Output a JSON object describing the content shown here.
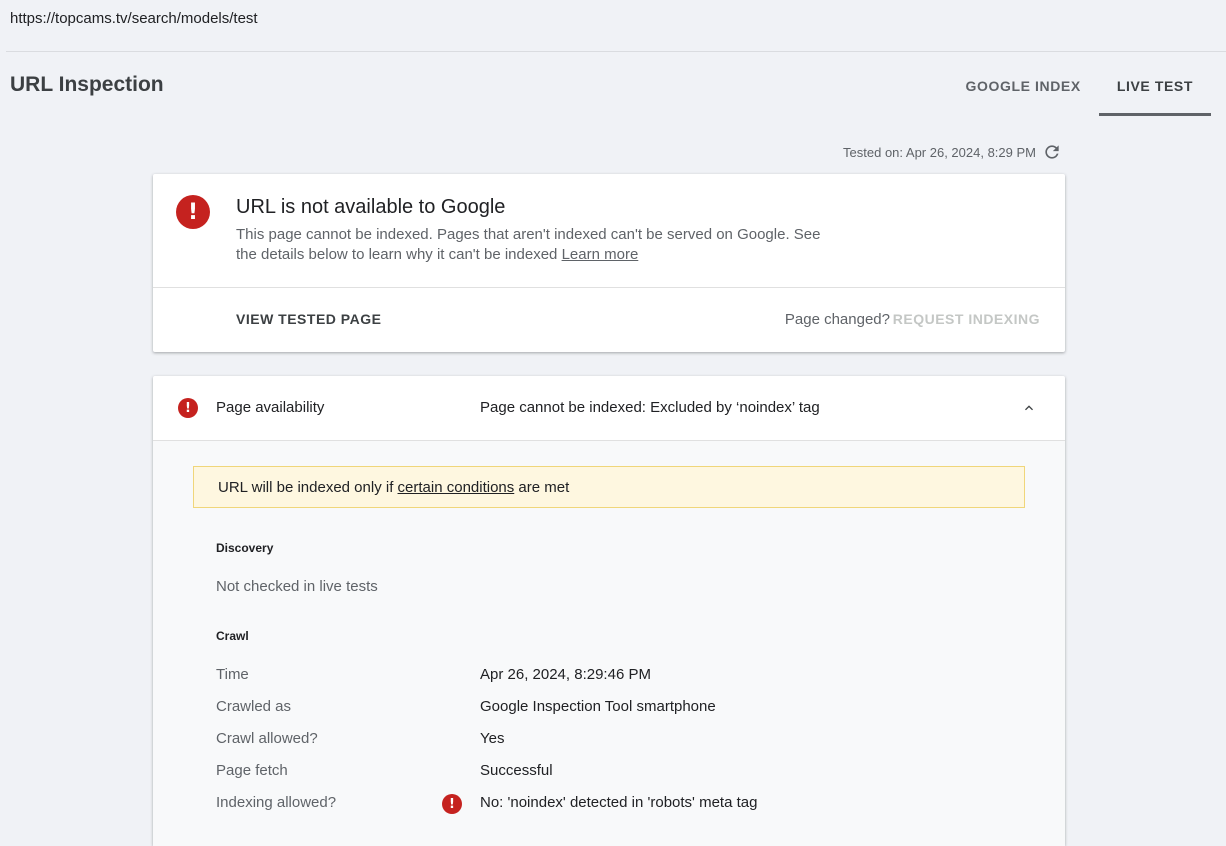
{
  "url": "https://topcams.tv/search/models/test",
  "header": {
    "title": "URL Inspection",
    "tabs": [
      {
        "label": "GOOGLE INDEX",
        "active": false
      },
      {
        "label": "LIVE TEST",
        "active": true
      }
    ]
  },
  "tested_on": "Tested on: Apr 26, 2024, 8:29 PM",
  "status_card": {
    "title": "URL is not available to Google",
    "description": "This page cannot be indexed. Pages that aren't indexed can't be served on Google. See the details below to learn why it can't be indexed",
    "learn_more": "Learn more",
    "view_tested_page": "VIEW TESTED PAGE",
    "page_changed": "Page changed?",
    "request_indexing": "REQUEST INDEXING"
  },
  "availability": {
    "label": "Page availability",
    "value": "Page cannot be indexed: Excluded by ‘noindex’ tag",
    "notice": {
      "prefix": "URL will be indexed only if ",
      "link": "certain conditions",
      "suffix": " are met"
    },
    "discovery": {
      "heading": "Discovery",
      "text": "Not checked in live tests"
    },
    "crawl": {
      "heading": "Crawl",
      "rows": [
        {
          "label": "Time",
          "value": "Apr 26, 2024, 8:29:46 PM"
        },
        {
          "label": "Crawled as",
          "value": "Google Inspection Tool smartphone"
        },
        {
          "label": "Crawl allowed?",
          "value": "Yes"
        },
        {
          "label": "Page fetch",
          "value": "Successful"
        },
        {
          "label": "Indexing allowed?",
          "value": "No: 'noindex' detected in 'robots' meta tag",
          "error": true
        }
      ]
    }
  },
  "colors": {
    "background": "#f0f2f6",
    "error": "#c5221f",
    "notice_bg": "#fef7e0",
    "notice_border": "#f0d67a"
  },
  "icons": [
    "error-icon",
    "refresh-icon",
    "chevron-up-icon"
  ]
}
